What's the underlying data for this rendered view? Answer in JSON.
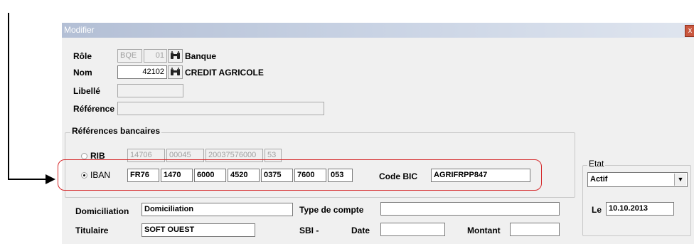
{
  "dialog": {
    "title": "Modifier",
    "close_glyph": "x"
  },
  "role": {
    "label": "Rôle",
    "code1": "BQE",
    "code2": "01",
    "name": "Banque"
  },
  "nom": {
    "label": "Nom",
    "value": "42102",
    "name": "CREDIT AGRICOLE"
  },
  "libelle": {
    "label": "Libellé",
    "value": ""
  },
  "reference": {
    "label": "Référence",
    "value": ""
  },
  "bank_refs": {
    "title": "Références bancaires",
    "rib": {
      "label": "RIB",
      "parts": [
        "14706",
        "00045",
        "20037576000",
        "53"
      ]
    },
    "iban": {
      "label": "IBAN",
      "parts": [
        "FR76",
        "1470",
        "6000",
        "4520",
        "0375",
        "7600",
        "053"
      ]
    },
    "bic": {
      "label": "Code BIC",
      "value": "AGRIFRPP847"
    }
  },
  "domiciliation": {
    "label": "Domiciliation",
    "value": "Domiciliation"
  },
  "type_compte": {
    "label": "Type de compte",
    "value": ""
  },
  "titulaire": {
    "label": "Titulaire",
    "value": "SOFT OUEST"
  },
  "sbi": {
    "label": "SBI -"
  },
  "date": {
    "label": "Date",
    "value": ""
  },
  "montant": {
    "label": "Montant",
    "value": ""
  },
  "etat": {
    "title": "Etat",
    "selected": "Actif",
    "le_label": "Le",
    "le_value": "10.10.2013"
  },
  "icons": {
    "binoculars": "binoculars-icon",
    "dropdown": "chevron-down-icon"
  },
  "colors": {
    "highlight": "#d5282a"
  }
}
